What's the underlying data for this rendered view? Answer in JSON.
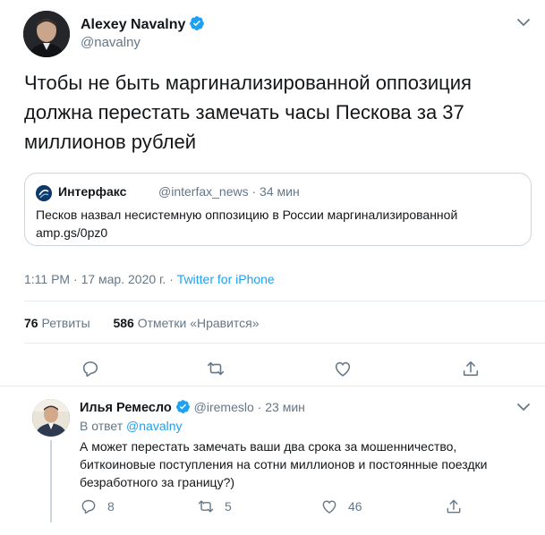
{
  "tweet": {
    "author_name": "Alexey Navalny",
    "author_handle": "@navalny",
    "text": "Чтобы не быть маргинализированной оппозиция должна перестать замечать часы Пескова за 37 миллионов рублей",
    "quote": {
      "name": "Интерфакс",
      "handle": "@interfax_news",
      "sep": "·",
      "time": "34 мин",
      "text_line1": "Песков назвал несистемную оппозицию в России маргинализированной",
      "text_line2": "amp.gs/0pz0"
    },
    "time": "1:11 PM",
    "sep1": "·",
    "date": "17 мар. 2020 г.",
    "sep2": "·",
    "source": "Twitter for iPhone",
    "retweets_count": "76",
    "retweets_label": "Ретвиты",
    "likes_count": "586",
    "likes_label": "Отметки «Нравится»"
  },
  "reply": {
    "author_name": "Илья Ремесло",
    "author_handle": "@iremeslo",
    "sep": "·",
    "time": "23 мин",
    "reply_to_label": "В ответ",
    "reply_to_mention": "@navalny",
    "text": "А может перестать замечать ваши два срока за мошенничество, биткоиновые поступления на сотни миллионов и постоянные поездки безработного за границу?)",
    "reply_count": "8",
    "retweet_count": "5",
    "like_count": "46"
  },
  "colors": {
    "accent": "#1da1f2",
    "secondary_text": "#657786",
    "border": "#e6ecf0"
  },
  "icons": [
    "verified-badge-icon",
    "chevron-down-icon",
    "reply-icon",
    "retweet-icon",
    "like-icon",
    "share-icon"
  ]
}
